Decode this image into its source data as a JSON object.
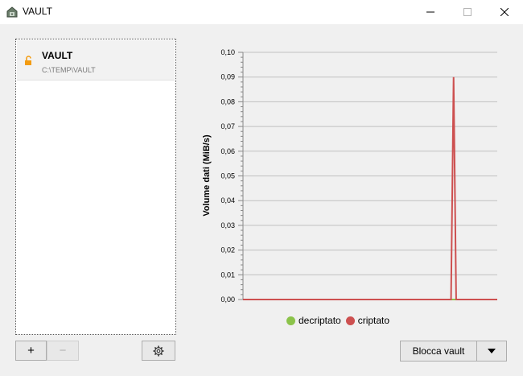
{
  "window": {
    "title": "VAULT",
    "controls": [
      "minimize-icon",
      "maximize-icon",
      "close-icon"
    ]
  },
  "vault_list": {
    "items": [
      {
        "name": "VAULT",
        "path": "C:\\TEMP\\VAULT",
        "icon": "unlocked-padlock-icon",
        "icon_color": "#f39c12"
      }
    ],
    "add_label": "+",
    "remove_label": "−",
    "settings_icon": "gear-icon"
  },
  "actions": {
    "lock_label": "Blocca vault",
    "more_icon": "triangle-down-icon"
  },
  "chart_data": {
    "type": "line",
    "ylabel": "Volume dati (MiB/s)",
    "xlabel": "",
    "ylim": [
      0,
      0.1
    ],
    "y_ticks": [
      "0,10",
      "0,09",
      "0,08",
      "0,07",
      "0,06",
      "0,05",
      "0,04",
      "0,03",
      "0,02",
      "0,01",
      "0,00"
    ],
    "grid": true,
    "legend_position": "bottom-center",
    "series": [
      {
        "name": "decriptato",
        "color": "#8bc34a",
        "values": [
          0,
          0,
          0,
          0,
          0,
          0,
          0,
          0,
          0,
          0,
          0,
          0,
          0,
          0,
          0,
          0,
          0,
          0,
          0,
          0,
          0,
          0,
          0,
          0,
          0,
          0,
          0,
          0,
          0,
          0,
          0,
          0,
          0,
          0,
          0,
          0,
          0,
          0,
          0,
          0,
          0,
          0,
          0,
          0,
          0,
          0,
          0,
          0,
          0,
          0,
          0,
          0,
          0,
          0,
          0,
          0,
          0,
          0,
          0,
          0,
          0,
          0,
          0,
          0,
          0,
          0,
          0,
          0,
          0,
          0,
          0,
          0,
          0,
          0,
          0,
          0,
          0,
          0,
          0,
          0,
          0,
          0,
          0,
          0,
          0,
          0,
          0,
          0,
          0,
          0,
          0,
          0,
          0,
          0,
          0,
          0,
          0,
          0,
          0,
          0
        ]
      },
      {
        "name": "criptato",
        "color": "#cd5050",
        "values": [
          0,
          0,
          0,
          0,
          0,
          0,
          0,
          0,
          0,
          0,
          0,
          0,
          0,
          0,
          0,
          0,
          0,
          0,
          0,
          0,
          0,
          0,
          0,
          0,
          0,
          0,
          0,
          0,
          0,
          0,
          0,
          0,
          0,
          0,
          0,
          0,
          0,
          0,
          0,
          0,
          0,
          0,
          0,
          0,
          0,
          0,
          0,
          0,
          0,
          0,
          0,
          0,
          0,
          0,
          0,
          0,
          0,
          0,
          0,
          0,
          0,
          0,
          0,
          0,
          0,
          0,
          0,
          0,
          0,
          0,
          0,
          0,
          0,
          0,
          0,
          0,
          0,
          0,
          0,
          0,
          0,
          0,
          0.09,
          0,
          0,
          0,
          0,
          0,
          0,
          0,
          0,
          0,
          0,
          0,
          0,
          0,
          0,
          0,
          0,
          0
        ]
      }
    ]
  }
}
